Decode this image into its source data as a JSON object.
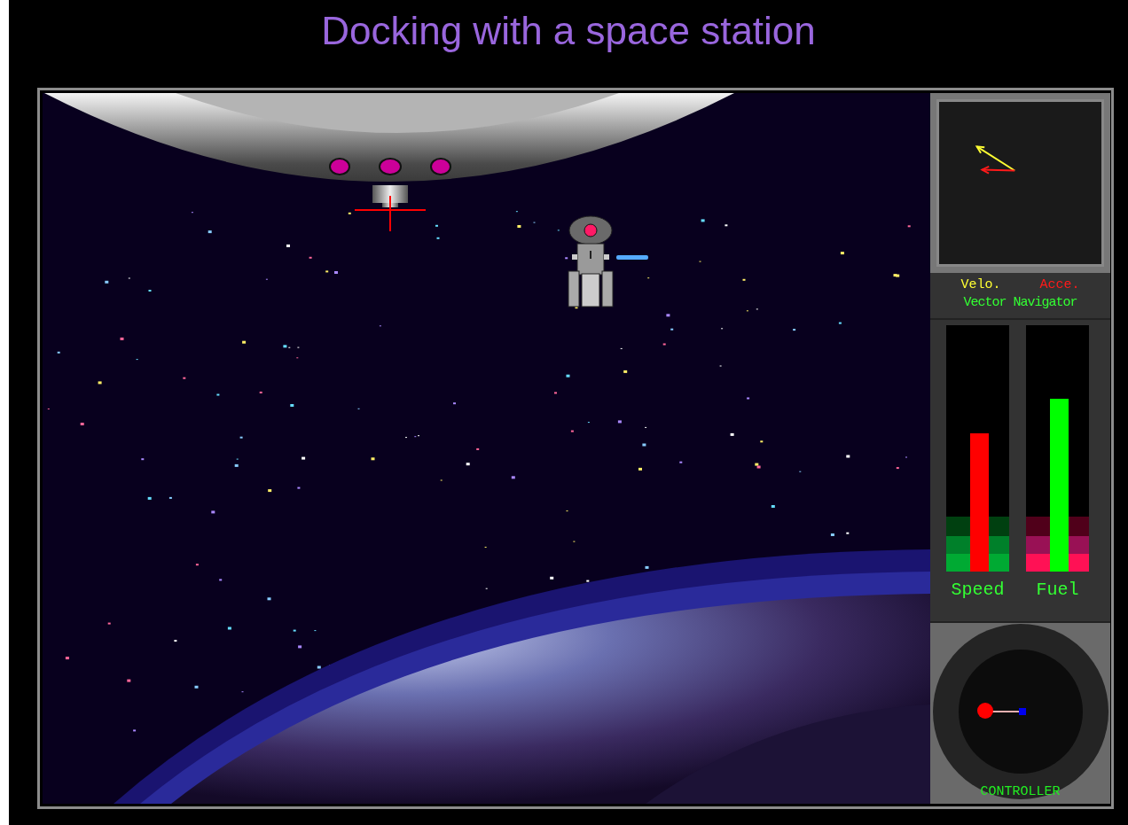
{
  "title": "Docking with a space station",
  "navigator": {
    "legend": [
      {
        "label": "Velo.",
        "color": "#ffff33"
      },
      {
        "label": "Acce.",
        "color": "#ff1a1a"
      }
    ],
    "caption": "Vector Navigator"
  },
  "gauges": [
    {
      "label": "Speed",
      "kind": "speed",
      "color": "#ff0000",
      "level": 0.56
    },
    {
      "label": "Fuel",
      "kind": "fuel",
      "color": "#00ff00",
      "level": 0.7
    }
  ],
  "controller": {
    "label": "CONTROLLER"
  }
}
